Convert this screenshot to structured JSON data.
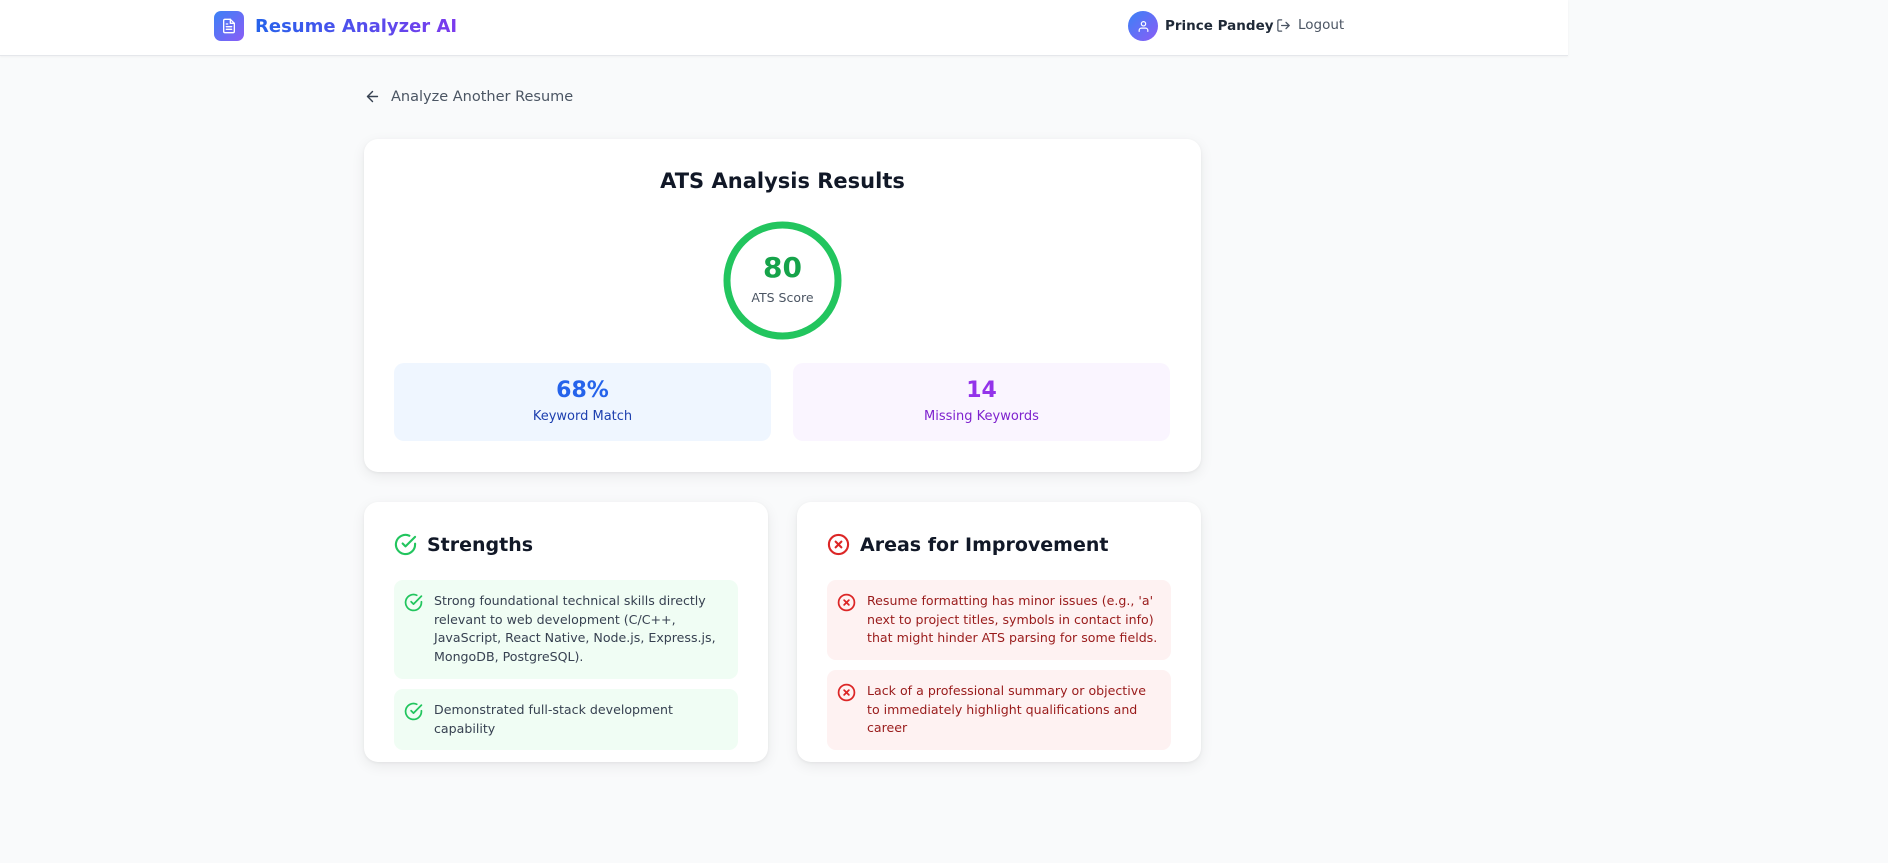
{
  "header": {
    "app_title": "Resume Analyzer AI",
    "user_name": "Prince Pandey",
    "logout_label": "Logout"
  },
  "nav": {
    "back_label": "Analyze Another Resume"
  },
  "results": {
    "title": "ATS Analysis Results",
    "score": "80",
    "score_label": "ATS Score",
    "score_fraction": 0.8,
    "keyword_match_value": "68%",
    "keyword_match_label": "Keyword Match",
    "missing_keywords_value": "14",
    "missing_keywords_label": "Missing Keywords"
  },
  "strengths": {
    "title": "Strengths",
    "items": [
      "Strong foundational technical skills directly relevant to web development (C/C++, JavaScript, React Native, Node.js, Express.js, MongoDB, PostgreSQL).",
      "Demonstrated full-stack development capability"
    ]
  },
  "improvements": {
    "title": "Areas for Improvement",
    "items": [
      "Resume formatting has minor issues (e.g., 'a' next to project titles, symbols in contact info) that might hinder ATS parsing for some fields.",
      "Lack of a professional summary or objective to immediately highlight qualifications and career"
    ]
  },
  "colors": {
    "brand_gradient_start": "#3b82f6",
    "brand_gradient_end": "#8b5cf6",
    "score_green": "#16a34a",
    "keyword_blue": "#2563eb",
    "missing_purple": "#9333ea",
    "strength_green": "#22c55e",
    "improve_red": "#dc2626"
  },
  "icons": {
    "brand": "document-icon",
    "avatar": "user-icon",
    "logout": "logout-icon",
    "back": "arrow-left-icon",
    "strength": "check-circle-icon",
    "improvement": "x-circle-icon"
  }
}
